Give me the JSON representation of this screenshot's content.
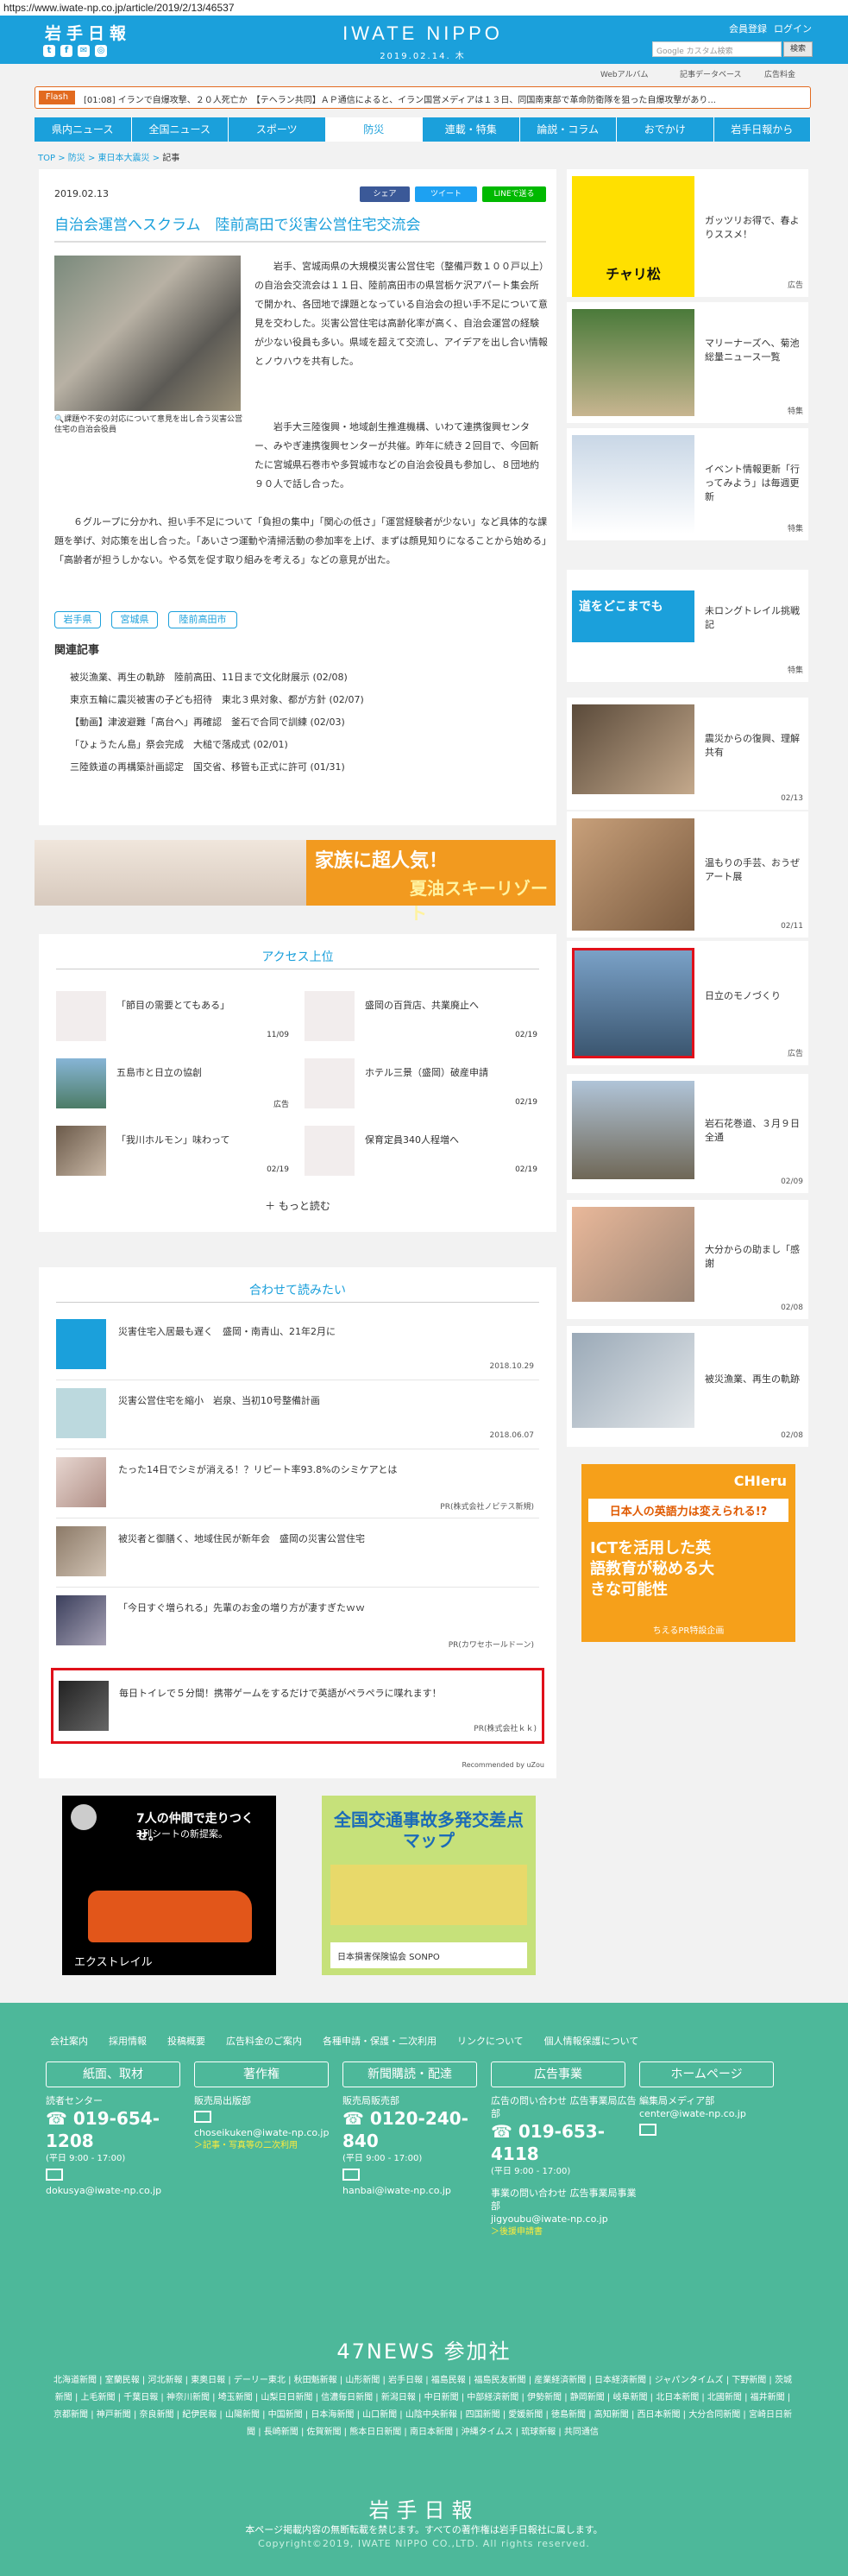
{
  "url": "https://www.iwate-np.co.jp/article/2019/2/13/46537",
  "header": {
    "logo_left": "岩手日報",
    "logo_center": "IWATE NIPPO",
    "date": "2019.02.14. 木",
    "links": [
      "会員登録",
      "ログイン"
    ],
    "search_placeholder": "Google カスタム検索",
    "search_button": "検索",
    "sub_links": [
      "Webアルバム",
      "記事データベース",
      "広告料金"
    ]
  },
  "flash": {
    "tag": "Flash",
    "text": "[01:08] イランで自爆攻撃、２０人死亡か　【テヘラン共同】ＡＰ通信によると、イラン国営メディアは１３日、同国南東部で革命防衛隊を狙った自爆攻撃があり..."
  },
  "nav": [
    "県内ニュース",
    "全国ニュース",
    "スポーツ",
    "防災",
    "連載・特集",
    "論説・コラム",
    "おでかけ",
    "岩手日報から"
  ],
  "nav_active": 3,
  "breadcrumb": [
    "TOP",
    "防災",
    "東日本大震災",
    "記事"
  ],
  "article": {
    "date": "2019.02.13",
    "share": [
      "シェア",
      "ツイート",
      "LINEで送る"
    ],
    "title": "自治会運営へスクラム　陸前高田で災害公営住宅交流会",
    "caption": "課題や不安の対応について意見を出し合う災害公営住宅の自治会役員",
    "para1": "岩手、宮城両県の大規模災害公営住宅（整備戸数１００戸以上）の自治会交流会は１１日、陸前高田市の県営栃ケ沢アパート集会所で開かれ、各団地で課題となっている自治会の担い手不足について意見を交わした。災害公営住宅は高齢化率が高く、自治会運営の経験が少ない役員も多い。県域を超えて交流し、アイデアを出し合い情報とノウハウを共有した。",
    "para2": "岩手大三陸復興・地域創生推進機構、いわて連携復興センター、みやぎ連携復興センターが共催。昨年に続き２回目で、今回新たに宮城県石巻市や多賀城市などの自治会役員も参加し、８団地約９０人で話し合った。",
    "para3": "６グループに分かれ、担い手不足について「負担の集中」「関心の低さ」「運営経験者が少ない」など具体的な課題を挙げ、対応策を出し合った。「あいさつ運動や清掃活動の参加率を上げ、まずは顔見知りになることから始める」「高齢者が担うしかない。やる気を促す取り組みを考える」などの意見が出た。",
    "tags": [
      "岩手県",
      "宮城県",
      "陸前高田市"
    ],
    "related_heading": "関連記事",
    "related": [
      "被災漁業、再生の軌跡　陸前高田、11日まで文化財展示 (02/08)",
      "東京五輪に震災被害の子ども招待　東北３県対象、都が方針 (02/07)",
      "【動画】津波避難「高台へ」再確認　釜石で合同で訓練 (02/03)",
      "「ひょうたん島」祭会完成　大槌で落成式 (02/01)",
      "三陸鉄道の再構築計画認定　国交省、移管も正式に許可 (01/31)"
    ]
  },
  "banner": {
    "line1": "家族に超人気！",
    "line2": "夏油スキーリゾート"
  },
  "access": {
    "heading": "アクセス上位",
    "items": [
      {
        "title": "「節目の需要とてもある」",
        "date": "11/09"
      },
      {
        "title": "盛岡の百貨店、共業廃止へ",
        "date": "02/19"
      },
      {
        "title": "五島市と日立の協創",
        "date": "広告"
      },
      {
        "title": "ホテル三景（盛岡）破産申請",
        "date": "02/19"
      },
      {
        "title": "「我川ホルモン」味わって",
        "date": "02/19"
      },
      {
        "title": "保育定員340人程増へ",
        "date": "02/19"
      }
    ],
    "more": "もっと読む"
  },
  "recommend": {
    "heading": "合わせて読みたい",
    "items": [
      {
        "title": "災害住宅入居最も遅く　盛岡・南青山、21年2月に",
        "meta": "2018.10.29"
      },
      {
        "title": "災害公営住宅を縮小　岩泉、当初10号整備計画",
        "meta": "2018.06.07"
      },
      {
        "title": "たった14日でシミが消える！？リピート率93.8%のシミケアとは",
        "meta": "PR(株式会社ノビテス新規)"
      },
      {
        "title": "被災者と御膳く、地域住民が新年会　盛岡の災害公営住宅",
        "meta": ""
      },
      {
        "title": "「今日すぐ増られる」先輩のお金の増り方が凄すぎたｗｗ",
        "meta": "PR(カワセホールドーン)"
      },
      {
        "title": "毎日トイレで５分間！携帯ゲームをするだけで英語がペラペラに喋れます！",
        "meta": "PR(株式会社ｋｋ)"
      }
    ],
    "footer": "Recommended by uZou"
  },
  "ads": {
    "nissan_text1": "7人の仲間で走りつくせ。",
    "nissan_text2": "3列シートの新提案。",
    "nissan_brand": "エクストレイル",
    "sonpo_title": "全国交通事故多発交差点マップ",
    "sonpo_brand": "日本損害保険協会 SONPO"
  },
  "sidebar": [
    {
      "text": "ガッツリお得で、春よりススメ！",
      "meta": "広告",
      "img_text": "チャリ松"
    },
    {
      "text": "マリーナーズへ、菊池総量ニュース一覧",
      "meta": "特集"
    },
    {
      "text": "イベント情報更新「行ってみよう」は毎週更新",
      "meta": "特集"
    },
    {
      "text": "未ロングトレイル挑戦記",
      "meta": "特集",
      "img_text": "道をどこまでも"
    },
    {
      "text": "震災からの復興、理解共有",
      "meta": "02/13"
    },
    {
      "text": "温もりの手芸、おうぜアート展",
      "meta": "02/11"
    },
    {
      "text": "日立のモノづくり",
      "meta": "広告"
    },
    {
      "text": "岩石花巻道、３月９日全通",
      "meta": "02/09"
    },
    {
      "text": "大分からの助まし「感謝",
      "meta": "02/08"
    },
    {
      "text": "被災漁業、再生の軌跡",
      "meta": "02/08"
    }
  ],
  "chieru": {
    "brand": "CHIeru",
    "line1": "日本人の英語力は変えられる!?",
    "line2": "ICTを活用した英語教育が秘める大きな可能性",
    "line3": "ちえるPR特設企画"
  },
  "footer": {
    "links": [
      "会社案内",
      "採用情報",
      "投稿概要",
      "広告料金のご案内",
      "各種申請・保護・二次利用",
      "リンクについて",
      "個人情報保護について"
    ],
    "buttons": [
      "紙面、取材",
      "著作権",
      "新聞購読・配達",
      "広告事業",
      "ホームページ"
    ],
    "col1": {
      "label": "読者センター",
      "phone": "019-654-1208",
      "hours": "(平日 9:00 - 17:00)",
      "mail": "dokusya@iwate-np.co.jp"
    },
    "col2": {
      "label": "販売局出版部",
      "mail": "choseikuken@iwate-np.co.jp",
      "link": "＞記事・写真等の二次利用"
    },
    "col3": {
      "label": "販売局販売部",
      "phone": "0120-240-840",
      "hours": "(平日 9:00 - 17:00)",
      "mail": "hanbai@iwate-np.co.jp"
    },
    "col4": {
      "label": "広告の問い合わせ 広告事業局広告部",
      "phone": "019-653-4118",
      "hours": "(平日 9:00 - 17:00)",
      "label2": "事業の問い合わせ 広告事業局事業部",
      "mail": "jigyoubu@iwate-np.co.jp",
      "link": "＞後援申請書"
    },
    "col5": {
      "label": "編集局メディア部",
      "mail": "center@iwate-np.co.jp"
    },
    "news_heading": "47NEWS 参加社",
    "news_list": "北海道新聞 | 室蘭民報 | 河北新報 | 東奥日報 | デーリー東北 | 秋田魁新報 | 山形新聞 | 岩手日報 | 福島民報 | 福島民友新聞 | 産業経済新聞 | 日本経済新聞 | ジャパンタイムズ | 下野新聞 | 茨城新聞 | 上毛新聞 | 千葉日報 | 神奈川新聞 | 埼玉新聞 | 山梨日日新聞 | 信濃毎日新聞 | 新潟日報 | 中日新聞 | 中部経済新聞 | 伊勢新聞 | 静岡新聞 | 岐阜新聞 | 北日本新聞 | 北國新聞 | 福井新聞 | 京都新聞 | 神戸新聞 | 奈良新聞 | 紀伊民報 | 山陽新聞 | 中国新聞 | 日本海新聞 | 山口新聞 | 山陰中央新報 | 四国新聞 | 愛媛新聞 | 徳島新聞 | 高知新聞 | 西日本新聞 | 大分合同新聞 | 宮崎日日新聞 | 長崎新聞 | 佐賀新聞 | 熊本日日新聞 | 南日本新聞 | 沖縄タイムス | 琉球新報 | 共同通信",
    "logo": "岩手日報",
    "note": "本ページ掲載内容の無断転載を禁じます。すべての著作権は岩手日報社に属します。",
    "copy": "Copyright©2019, IWATE NIPPO CO.,LTD. All rights reserved."
  }
}
